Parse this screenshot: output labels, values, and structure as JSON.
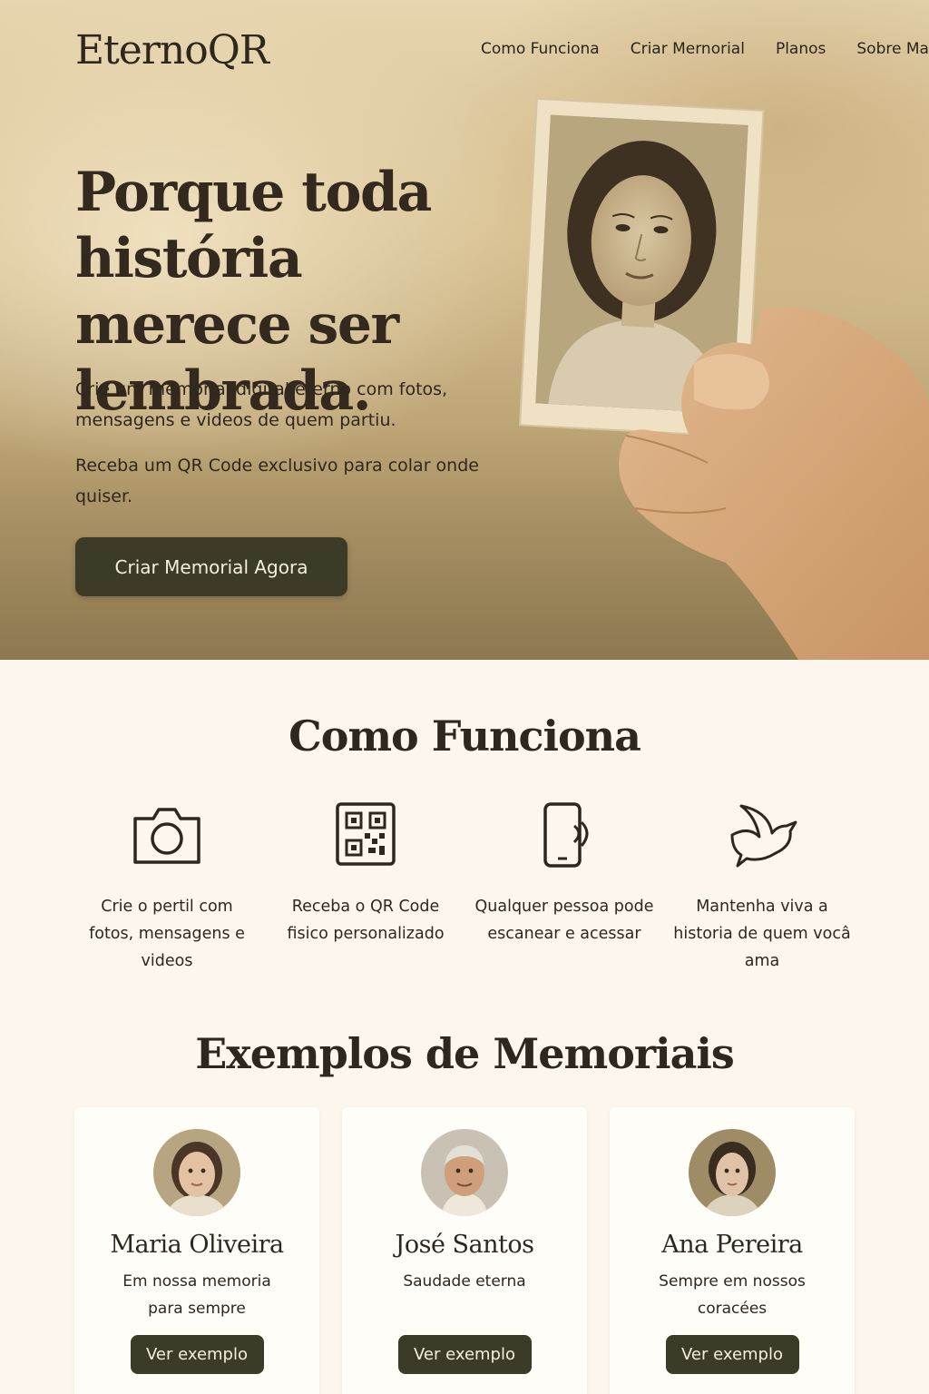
{
  "brand": {
    "logo": "EternoQR"
  },
  "nav": {
    "items": [
      "Como Funciona",
      "Criar Mernorial",
      "Planos",
      "Sobre Ma"
    ]
  },
  "hero": {
    "headline": "Porque toda história merece ser lembrada.",
    "subtitle1": "Crie um memorial digital eterno com fotos, mensagens e videos de quem partiu.",
    "subtitle2": "Receba um QR Code exclusivo para colar onde quiser.",
    "cta_label": "Criar Memorial Agora"
  },
  "how": {
    "title": "Como Funciona",
    "steps": [
      {
        "icon": "camera-icon",
        "text": "Crie o pertil com fotos, mensagens e videos"
      },
      {
        "icon": "qr-code-icon",
        "text": "Receba o QR Code fisico personalizado"
      },
      {
        "icon": "phone-scan-icon",
        "text": "Qualquer pessoa pode escanear e acessar"
      },
      {
        "icon": "dove-icon",
        "text": "Mantenha viva a historia de quem vocâ ama"
      }
    ]
  },
  "examples": {
    "title": "Exemplos de Memoriais",
    "cards": [
      {
        "name": "Maria Oliveira",
        "message": "Em nossa memoria para sempre",
        "button": "Ver exemplo"
      },
      {
        "name": "José Santos",
        "message": "Saudade eterna",
        "button": "Ver exemplo"
      },
      {
        "name": "Ana Pereira",
        "message": "Sempre em nossos coracées",
        "button": "Ver exemplo"
      }
    ]
  },
  "colors": {
    "accent": "#3b3b27",
    "background": "#fcf6ec",
    "text": "#2e271d",
    "hero_tone": "#d8c192"
  }
}
